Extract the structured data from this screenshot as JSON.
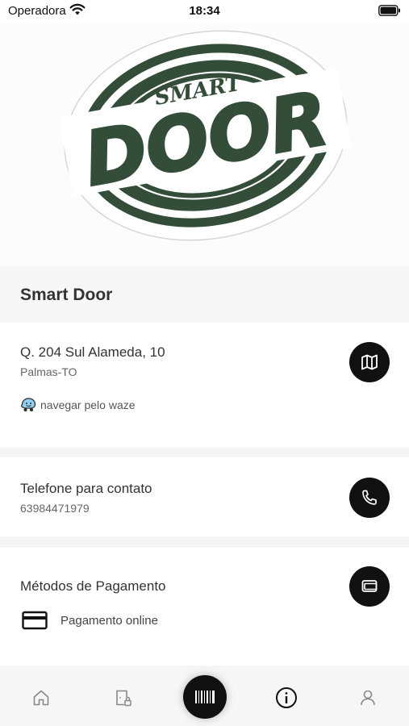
{
  "status_bar": {
    "carrier": "Operadora",
    "time": "18:34"
  },
  "logo": {
    "top_word": "SMART",
    "main_word": "DOOR",
    "color": "#344d38"
  },
  "shop": {
    "name": "Smart Door"
  },
  "address": {
    "street": "Q. 204 Sul Alameda, 10",
    "city": "Palmas-TO",
    "waze_label": "navegar pelo waze",
    "map_button_icon": "map-icon"
  },
  "contact": {
    "title": "Telefone para contato",
    "phone": "63984471979",
    "button_icon": "phone-icon"
  },
  "payment": {
    "title": "Métodos de Pagamento",
    "method": "Pagamento online",
    "button_icon": "wallet-icon"
  },
  "tab_bar": {
    "tabs": [
      "home-icon",
      "door-lock-icon",
      "barcode-icon",
      "info-icon",
      "user-icon"
    ],
    "active": "info-icon"
  }
}
